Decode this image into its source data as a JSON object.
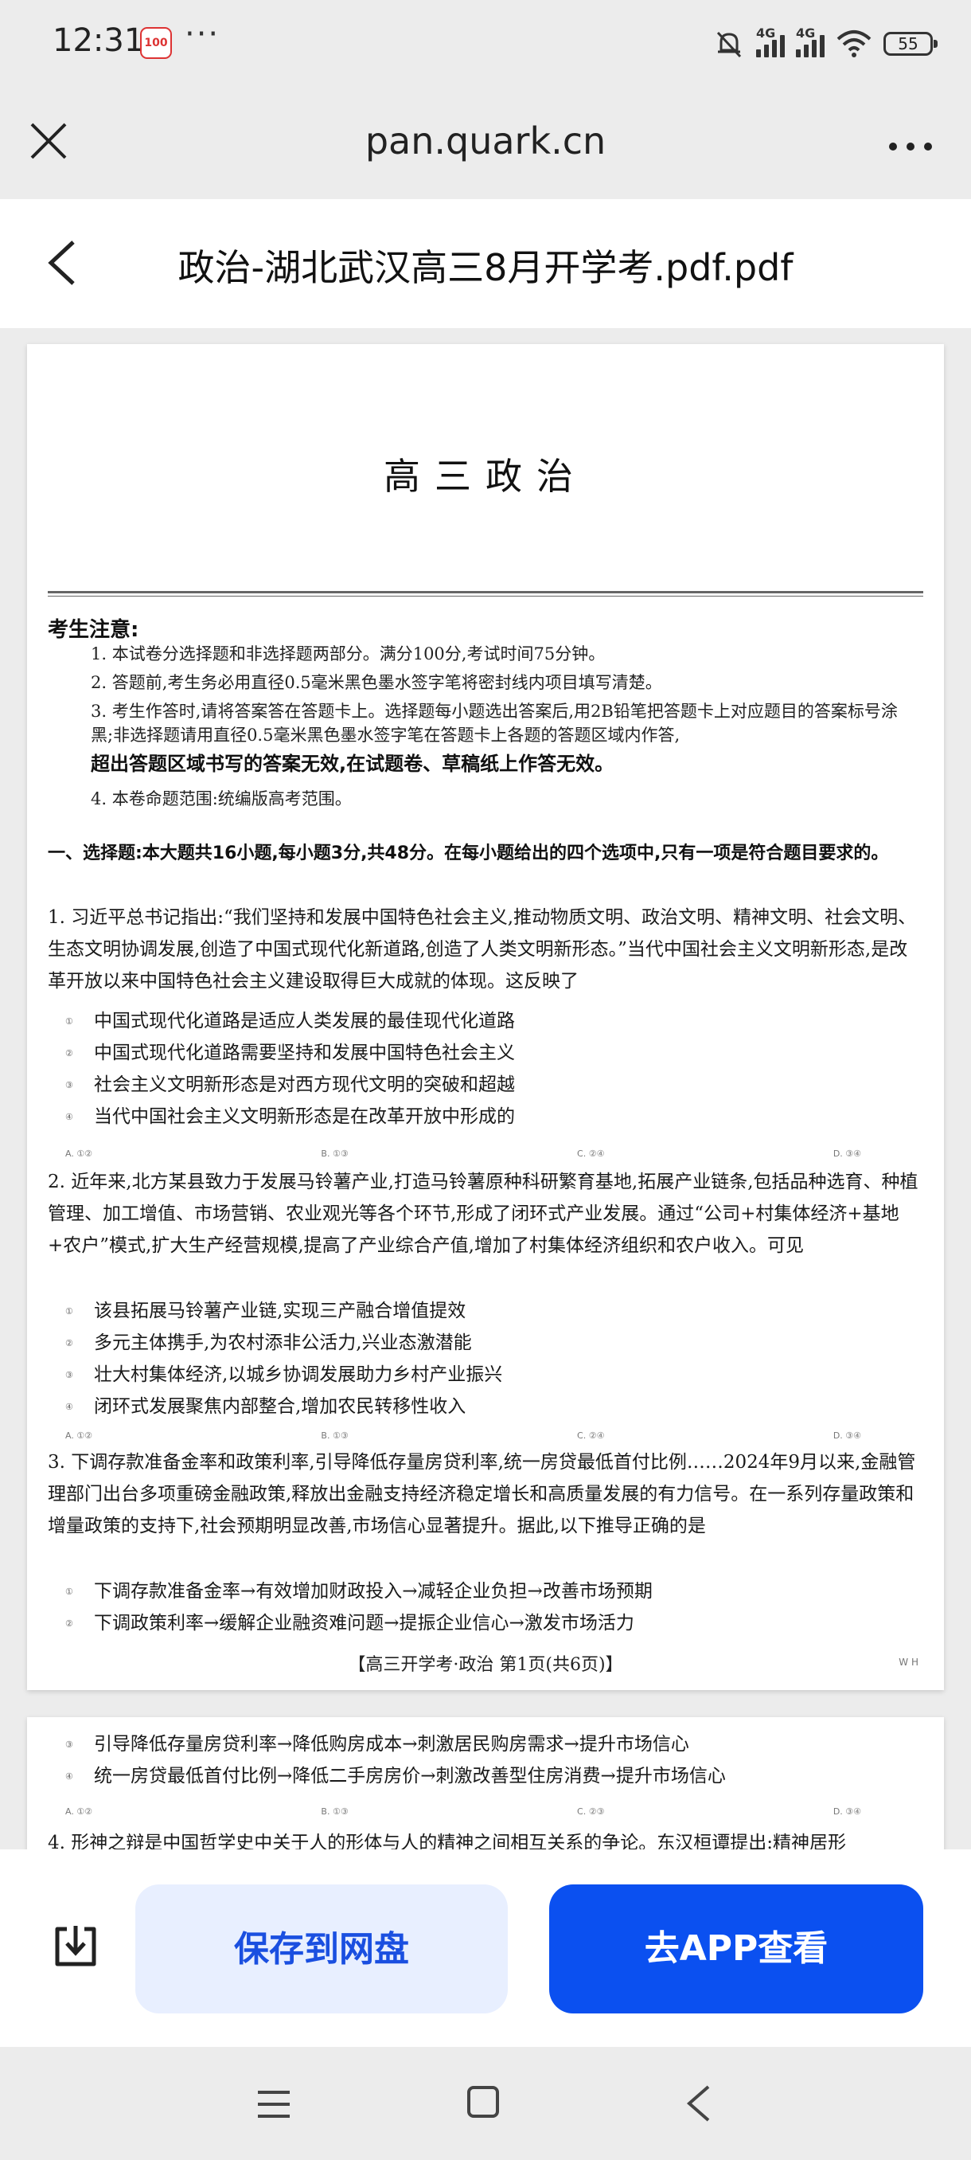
{
  "status_bar": {
    "time": "12:31",
    "app_badge": "100",
    "more": "···",
    "net1": "4G",
    "net2": "4G",
    "battery": "55"
  },
  "browser": {
    "url": "pan.quark.cn"
  },
  "document": {
    "title": "政治-湖北武汉高三8月开学考.pdf.pdf"
  },
  "page1": {
    "title": "高三政治",
    "notice_head": "考生注意:",
    "notices": [
      "1. 本试卷分选择题和非选择题两部分。满分100分,考试时间75分钟。",
      "2. 答题前,考生务必用直径0.5毫米黑色墨水签字笔将密封线内项目填写清楚。",
      "3. 考生作答时,请将答案答在答题卡上。选择题每小题选出答案后,用2B铅笔把答题卡上对应题目的答案标号涂黑;非选择题请用直径0.5毫米黑色墨水签字笔在答题卡上各题的答题区域内作答,",
      "4. 本卷命题范围:统编版高考范围。"
    ],
    "notice_bold": "超出答题区域书写的答案无效,在试题卷、草稿纸上作答无效。",
    "section": "一、选择题:本大题共16小题,每小题3分,共48分。在每小题给出的四个选项中,只有一项是符合题目要求的。",
    "questions": [
      {
        "text": "1. 习近平总书记指出:“我们坚持和发展中国特色社会主义,推动物质文明、政治文明、精神文明、社会文明、生态文明协调发展,创造了中国式现代化新道路,创造了人类文明新形态。”当代中国社会主义文明新形态,是改革开放以来中国特色社会主义建设取得巨大成就的体现。这反映了",
        "options": [
          "中国式现代化道路是适应人类发展的最佳现代化道路",
          "中国式现代化道路需要坚持和发展中国特色社会主义",
          "社会主义文明新形态是对西方现代文明的突破和超越",
          "当代中国社会主义文明新形态是在改革开放中形成的"
        ],
        "choices": [
          "A. ①②",
          "B. ①③",
          "C. ②④",
          "D. ③④"
        ]
      },
      {
        "text": "2. 近年来,北方某县致力于发展马铃薯产业,打造马铃薯原种科研繁育基地,拓展产业链条,包括品种选育、种植管理、加工增值、市场营销、农业观光等各个环节,形成了闭环式产业发展。通过“公司+村集体经济+基地+农户”模式,扩大生产经营规模,提高了产业综合产值,增加了村集体经济组织和农户收入。可见",
        "options": [
          "该县拓展马铃薯产业链,实现三产融合增值提效",
          "多元主体携手,为农村添非公活力,兴业态激潜能",
          "壮大村集体经济,以城乡协调发展助力乡村产业振兴",
          "闭环式发展聚焦内部整合,增加农民转移性收入"
        ],
        "choices": [
          "A. ①②",
          "B. ①③",
          "C. ②④",
          "D. ③④"
        ]
      },
      {
        "text": "3. 下调存款准备金率和政策利率,引导降低存量房贷利率,统一房贷最低首付比例……2024年9月以来,金融管理部门出台多项重磅金融政策,释放出金融支持经济稳定增长和高质量发展的有力信号。在一系列存量政策和增量政策的支持下,社会预期明显改善,市场信心显著提升。据此,以下推导正确的是",
        "options": [
          "下调存款准备金率→有效增加财政投入→减轻企业负担→改善市场预期",
          "下调政策利率→缓解企业融资难问题→提振企业信心→激发市场活力"
        ]
      }
    ],
    "footer": "【高三开学考·政治 第1页(共6页)】",
    "footer_code": "W H"
  },
  "page2": {
    "options": [
      "引导降低存量房贷利率→降低购房成本→刺激居民购房需求→提升市场信心",
      "统一房贷最低首付比例→降低二手房房价→刺激改善型住房消费→提升市场信心"
    ],
    "choices": [
      "A. ①②",
      "B. ①③",
      "C. ②③",
      "D. ③④"
    ],
    "next_text": "4. 形神之辩是中国哲学史中关于人的形体与人的精神之间相互关系的争论。东汉桓谭提出:精神居形"
  },
  "bottom": {
    "save_label": "保存到网盘",
    "app_label": "去APP查看"
  },
  "colors": {
    "accent": "#0b50f0",
    "save_bg": "#e8efff"
  }
}
